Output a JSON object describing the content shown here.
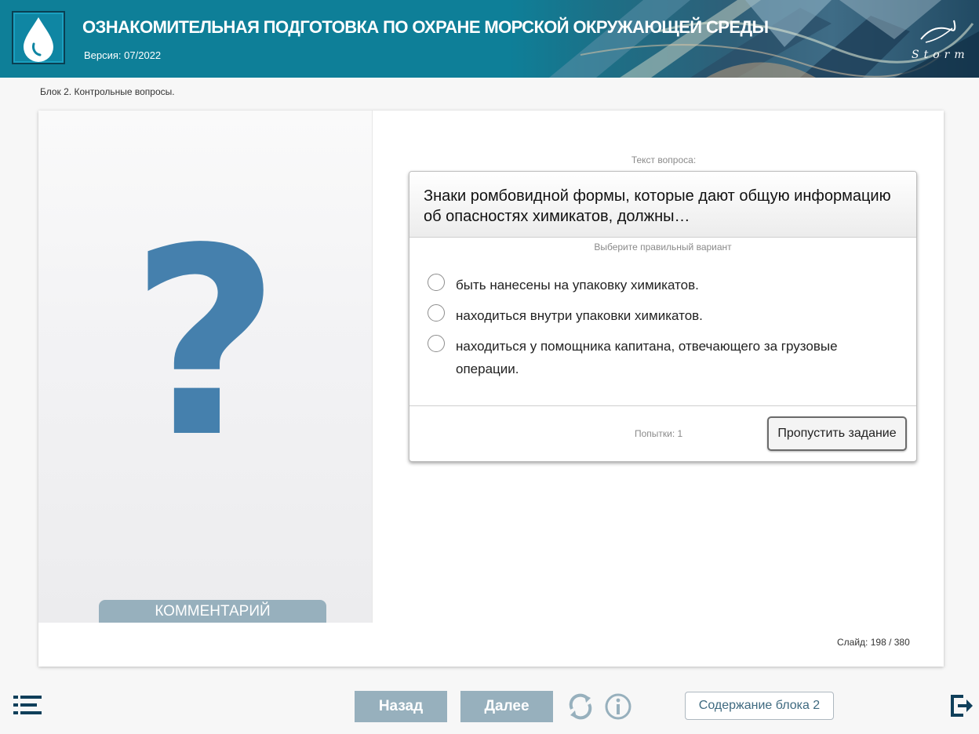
{
  "header": {
    "title": "ОЗНАКОМИТЕЛЬНАЯ ПОДГОТОВКА ПО ОХРАНЕ МОРСКОЙ ОКРУЖАЮЩЕЙ СРЕДЫ",
    "version": "Версия: 07/2022",
    "logo_icon": "water-drop-icon",
    "brand_text": "Storm"
  },
  "breadcrumb": "Блок 2. Контрольные вопросы.",
  "left_panel": {
    "illustration": "?",
    "comment_label": "КОММЕНТАРИЙ"
  },
  "question": {
    "caption": "Текст вопроса:",
    "text": "Знаки ромбовидной формы, которые дают общую информацию об опасностях химикатов, должны…",
    "hint": "Выберите правильный вариант",
    "options": [
      {
        "label": "быть нанесены на упаковку химикатов.",
        "selected": false
      },
      {
        "label": "находиться внутри упаковки химикатов.",
        "selected": false
      },
      {
        "label": "находиться у помощника капитана, отвечающего за грузовые операции.",
        "selected": false
      }
    ],
    "attempts": "Попытки: 1",
    "skip_label": "Пропустить задание"
  },
  "slide_counter": "Слайд:  198 / 380",
  "footer": {
    "menu_icon": "list-menu-icon",
    "back_label": "Назад",
    "next_label": "Далее",
    "reload_icon": "reload-icon",
    "info_icon": "info-icon",
    "contents_label": "Содержание блока 2",
    "exit_icon": "exit-icon"
  },
  "colors": {
    "header_teal": "#0e7f98",
    "accent_blue": "#4580ad",
    "button_gray_blue": "#97b0bd",
    "nav_dark": "#0f3f5a"
  }
}
